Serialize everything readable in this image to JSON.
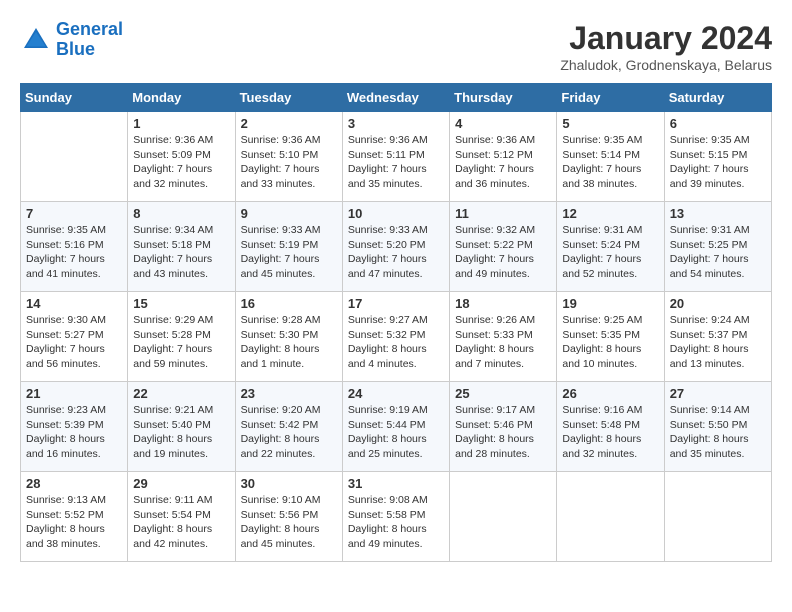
{
  "header": {
    "logo_line1": "General",
    "logo_line2": "Blue",
    "month_title": "January 2024",
    "subtitle": "Zhaludok, Grodnenskaya, Belarus"
  },
  "days_of_week": [
    "Sunday",
    "Monday",
    "Tuesday",
    "Wednesday",
    "Thursday",
    "Friday",
    "Saturday"
  ],
  "weeks": [
    [
      {
        "day": "",
        "content": ""
      },
      {
        "day": "1",
        "content": "Sunrise: 9:36 AM\nSunset: 5:09 PM\nDaylight: 7 hours\nand 32 minutes."
      },
      {
        "day": "2",
        "content": "Sunrise: 9:36 AM\nSunset: 5:10 PM\nDaylight: 7 hours\nand 33 minutes."
      },
      {
        "day": "3",
        "content": "Sunrise: 9:36 AM\nSunset: 5:11 PM\nDaylight: 7 hours\nand 35 minutes."
      },
      {
        "day": "4",
        "content": "Sunrise: 9:36 AM\nSunset: 5:12 PM\nDaylight: 7 hours\nand 36 minutes."
      },
      {
        "day": "5",
        "content": "Sunrise: 9:35 AM\nSunset: 5:14 PM\nDaylight: 7 hours\nand 38 minutes."
      },
      {
        "day": "6",
        "content": "Sunrise: 9:35 AM\nSunset: 5:15 PM\nDaylight: 7 hours\nand 39 minutes."
      }
    ],
    [
      {
        "day": "7",
        "content": "Sunrise: 9:35 AM\nSunset: 5:16 PM\nDaylight: 7 hours\nand 41 minutes."
      },
      {
        "day": "8",
        "content": "Sunrise: 9:34 AM\nSunset: 5:18 PM\nDaylight: 7 hours\nand 43 minutes."
      },
      {
        "day": "9",
        "content": "Sunrise: 9:33 AM\nSunset: 5:19 PM\nDaylight: 7 hours\nand 45 minutes."
      },
      {
        "day": "10",
        "content": "Sunrise: 9:33 AM\nSunset: 5:20 PM\nDaylight: 7 hours\nand 47 minutes."
      },
      {
        "day": "11",
        "content": "Sunrise: 9:32 AM\nSunset: 5:22 PM\nDaylight: 7 hours\nand 49 minutes."
      },
      {
        "day": "12",
        "content": "Sunrise: 9:31 AM\nSunset: 5:24 PM\nDaylight: 7 hours\nand 52 minutes."
      },
      {
        "day": "13",
        "content": "Sunrise: 9:31 AM\nSunset: 5:25 PM\nDaylight: 7 hours\nand 54 minutes."
      }
    ],
    [
      {
        "day": "14",
        "content": "Sunrise: 9:30 AM\nSunset: 5:27 PM\nDaylight: 7 hours\nand 56 minutes."
      },
      {
        "day": "15",
        "content": "Sunrise: 9:29 AM\nSunset: 5:28 PM\nDaylight: 7 hours\nand 59 minutes."
      },
      {
        "day": "16",
        "content": "Sunrise: 9:28 AM\nSunset: 5:30 PM\nDaylight: 8 hours\nand 1 minute."
      },
      {
        "day": "17",
        "content": "Sunrise: 9:27 AM\nSunset: 5:32 PM\nDaylight: 8 hours\nand 4 minutes."
      },
      {
        "day": "18",
        "content": "Sunrise: 9:26 AM\nSunset: 5:33 PM\nDaylight: 8 hours\nand 7 minutes."
      },
      {
        "day": "19",
        "content": "Sunrise: 9:25 AM\nSunset: 5:35 PM\nDaylight: 8 hours\nand 10 minutes."
      },
      {
        "day": "20",
        "content": "Sunrise: 9:24 AM\nSunset: 5:37 PM\nDaylight: 8 hours\nand 13 minutes."
      }
    ],
    [
      {
        "day": "21",
        "content": "Sunrise: 9:23 AM\nSunset: 5:39 PM\nDaylight: 8 hours\nand 16 minutes."
      },
      {
        "day": "22",
        "content": "Sunrise: 9:21 AM\nSunset: 5:40 PM\nDaylight: 8 hours\nand 19 minutes."
      },
      {
        "day": "23",
        "content": "Sunrise: 9:20 AM\nSunset: 5:42 PM\nDaylight: 8 hours\nand 22 minutes."
      },
      {
        "day": "24",
        "content": "Sunrise: 9:19 AM\nSunset: 5:44 PM\nDaylight: 8 hours\nand 25 minutes."
      },
      {
        "day": "25",
        "content": "Sunrise: 9:17 AM\nSunset: 5:46 PM\nDaylight: 8 hours\nand 28 minutes."
      },
      {
        "day": "26",
        "content": "Sunrise: 9:16 AM\nSunset: 5:48 PM\nDaylight: 8 hours\nand 32 minutes."
      },
      {
        "day": "27",
        "content": "Sunrise: 9:14 AM\nSunset: 5:50 PM\nDaylight: 8 hours\nand 35 minutes."
      }
    ],
    [
      {
        "day": "28",
        "content": "Sunrise: 9:13 AM\nSunset: 5:52 PM\nDaylight: 8 hours\nand 38 minutes."
      },
      {
        "day": "29",
        "content": "Sunrise: 9:11 AM\nSunset: 5:54 PM\nDaylight: 8 hours\nand 42 minutes."
      },
      {
        "day": "30",
        "content": "Sunrise: 9:10 AM\nSunset: 5:56 PM\nDaylight: 8 hours\nand 45 minutes."
      },
      {
        "day": "31",
        "content": "Sunrise: 9:08 AM\nSunset: 5:58 PM\nDaylight: 8 hours\nand 49 minutes."
      },
      {
        "day": "",
        "content": ""
      },
      {
        "day": "",
        "content": ""
      },
      {
        "day": "",
        "content": ""
      }
    ]
  ]
}
